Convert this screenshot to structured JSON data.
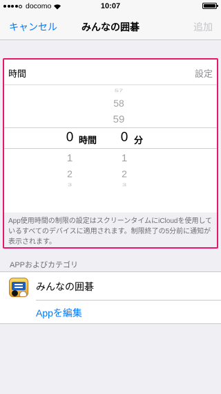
{
  "status_bar": {
    "carrier": "docomo",
    "time": "10:07",
    "signal_bars_filled": 4,
    "signal_bars_total": 5,
    "battery_level": 1.0,
    "icons": [
      "signal-dots-icon",
      "wifi-icon",
      "battery-icon"
    ]
  },
  "nav": {
    "cancel_label": "キャンセル",
    "title": "みんなの囲碁",
    "add_label": "追加"
  },
  "time_setting": {
    "label": "時間",
    "value": "設定",
    "picker": {
      "hours": {
        "above": [
          "57",
          "58",
          "59"
        ],
        "selected": "0",
        "unit": "時間",
        "below": [
          "1",
          "2",
          "3"
        ]
      },
      "minutes": {
        "selected": "0",
        "unit": "分",
        "below": [
          "1",
          "2",
          "3"
        ]
      }
    },
    "note": "App使用時間の制限の設定はスクリーンタイムにiCloudを使用しているすべてのデバイスに適用されます。制限終了の5分前に通知が表示されます。"
  },
  "apps_section": {
    "header": "APPおよびカテゴリ",
    "app_name": "みんなの囲碁",
    "edit_label": "Appを編集"
  },
  "colors": {
    "accent": "#007aff",
    "highlight": "#e6186b",
    "disabled": "#c4c4c9",
    "secondary_text": "#6d6d72",
    "background": "#efeff4"
  }
}
